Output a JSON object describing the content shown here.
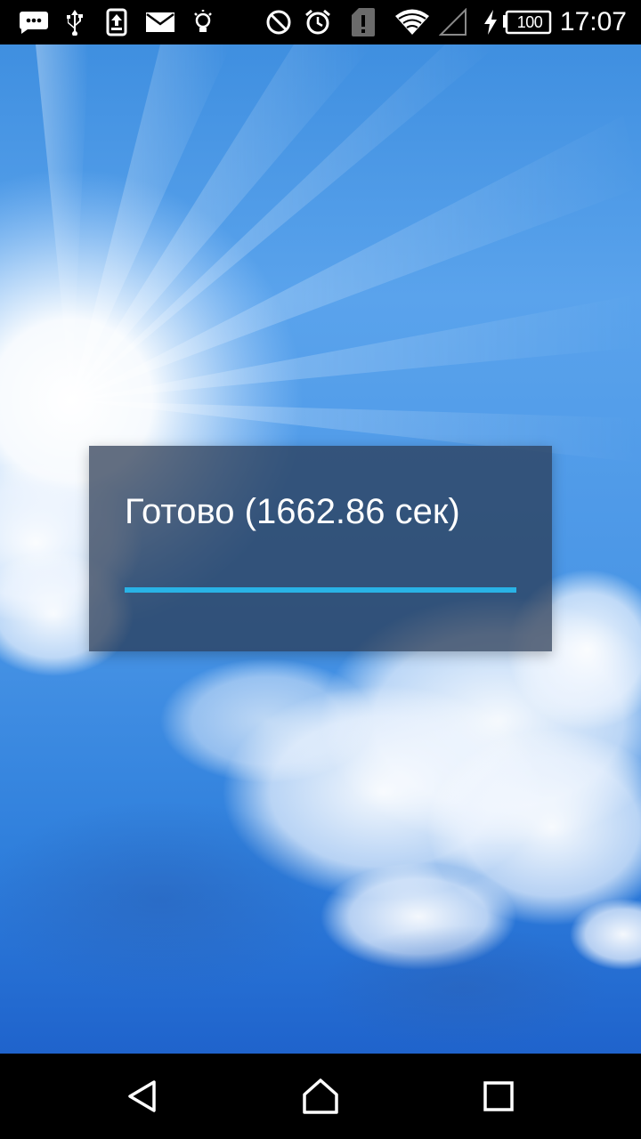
{
  "status_bar": {
    "battery_level": "100",
    "time": "17:07",
    "icons": [
      "chat-bubble-icon",
      "usb-icon",
      "upload-icon",
      "mail-icon",
      "bulb-icon",
      "do-not-disturb-icon",
      "alarm-icon",
      "sim-alert-icon",
      "wifi-icon",
      "signal-icon",
      "charging-icon",
      "battery-icon"
    ]
  },
  "dialog": {
    "message": "Готово (1662.86 сек)",
    "progress_fraction": 1.0,
    "progress_color": "#29b3e6"
  },
  "navigation": {
    "icons": [
      "back-icon",
      "home-icon",
      "recents-icon"
    ]
  }
}
